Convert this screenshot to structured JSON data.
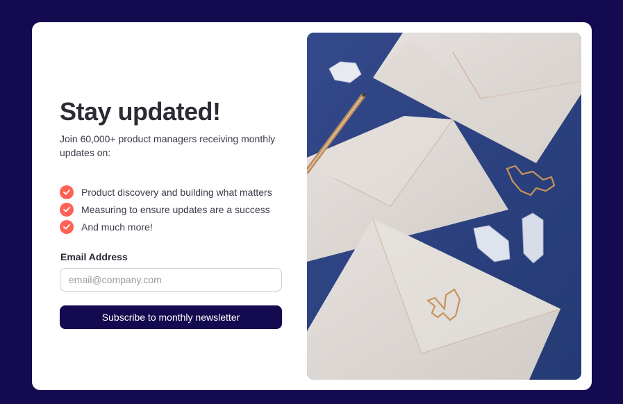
{
  "signup": {
    "title": "Stay updated!",
    "intro": "Join 60,000+ product managers receiving monthly updates on:",
    "features": [
      "Product discovery and building what matters",
      "Measuring to ensure updates are a success",
      "And much more!"
    ],
    "email_label": "Email Address",
    "email_placeholder": "email@company.com",
    "email_value": "",
    "button_label": "Subscribe to monthly newsletter"
  },
  "colors": {
    "page_background": "#140a4f",
    "accent": "#ff6155",
    "button": "#140a4f"
  },
  "icons": {
    "feature_check": "check-circle-icon"
  }
}
